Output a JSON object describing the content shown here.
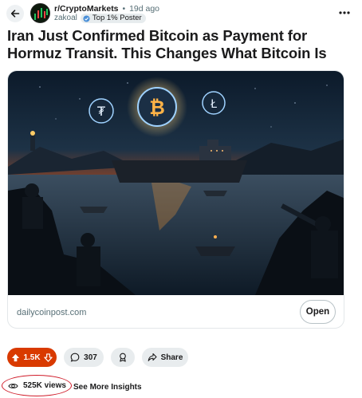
{
  "post": {
    "subreddit": "r/CryptoMarkets",
    "separator": "•",
    "age": "19d ago",
    "username": "zakoal",
    "flair": "Top 1% Poster",
    "title": "Iran Just Confirmed Bitcoin as Payment for Hormuz Transit. This Changes What Bitcoin Is"
  },
  "link_card": {
    "domain": "dailycoinpost.com",
    "open_label": "Open"
  },
  "actions": {
    "votes": "1.5K",
    "comments": "307",
    "share_label": "Share"
  },
  "insights": {
    "views": "525K views",
    "see_more": "See More Insights"
  },
  "colors": {
    "upvote_active": "#d93a00",
    "annotation_ring": "#d01c2a",
    "pill_bg": "#e8ecee"
  },
  "icons": [
    "back-arrow-icon",
    "subreddit-avatar-icon",
    "flair-badge-icon",
    "more-options-icon",
    "upvote-icon",
    "downvote-icon",
    "comment-icon",
    "award-icon",
    "share-icon",
    "eye-icon"
  ]
}
